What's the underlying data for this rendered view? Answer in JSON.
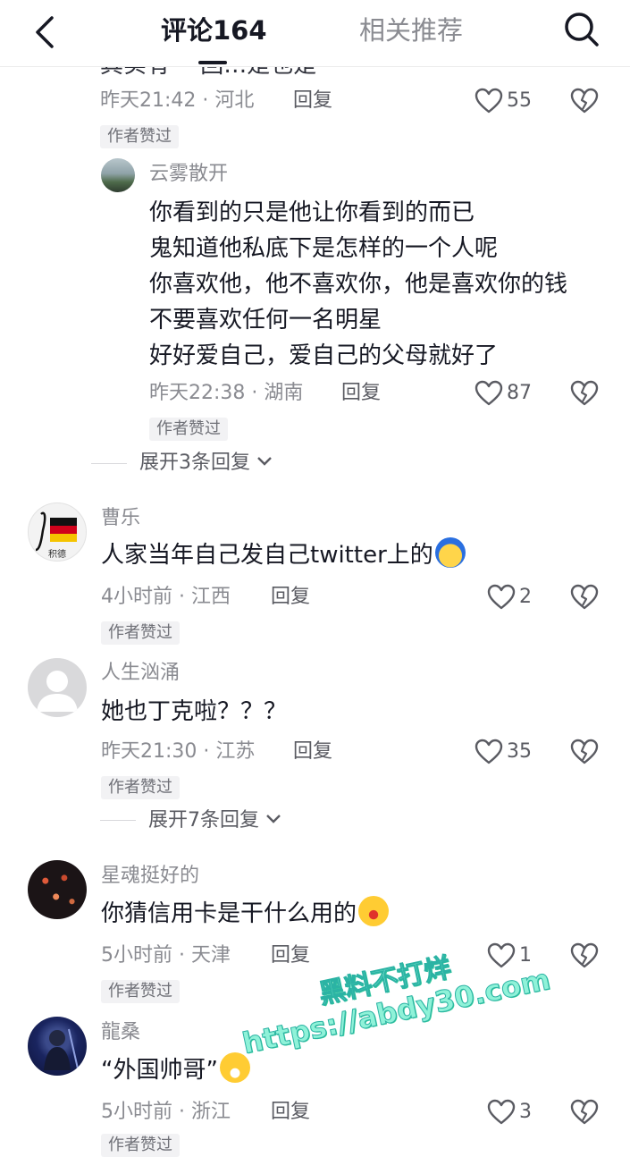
{
  "header": {
    "tab_comments": "评论164",
    "tab_related": "相关推荐"
  },
  "top_cut_text": "其实有 一回…是也是",
  "comments": [
    {
      "meta": "昨天21:42 · 河北",
      "reply": "回复",
      "likes": "55",
      "badge": "作者赞过",
      "sub_reply": {
        "username": "云雾散开",
        "lines": [
          "你看到的只是他让你看到的而已",
          "鬼知道他私底下是怎样的一个人呢",
          "你喜欢他，他不喜欢你，他是喜欢你的钱",
          "不要喜欢任何一名明星",
          "好好爱自己，爱自己的父母就好了"
        ],
        "meta": "昨天22:38 · 湖南",
        "reply": "回复",
        "likes": "87",
        "badge": "作者赞过"
      },
      "expand": "展开3条回复"
    },
    {
      "username": "曹乐",
      "avatar_caption": "积德",
      "text": "人家当年自己发自己twitter上的",
      "meta": "4小时前 · 江西",
      "reply": "回复",
      "likes": "2",
      "badge": "作者赞过"
    },
    {
      "username": "人生汹涌",
      "text": "她也丁克啦？？？",
      "meta": "昨天21:30 · 江苏",
      "reply": "回复",
      "likes": "35",
      "badge": "作者赞过",
      "expand": "展开7条回复"
    },
    {
      "username": "星魂挺好的",
      "text": "你猜信用卡是干什么用的",
      "meta": "5小时前 · 天津",
      "reply": "回复",
      "likes": "1",
      "badge": "作者赞过"
    },
    {
      "username": "龍桑",
      "text": "“外国帅哥”",
      "meta": "5小时前 · 浙江",
      "reply": "回复",
      "likes": "3",
      "badge": "作者赞过"
    }
  ],
  "watermark": {
    "line1": "黑料不打烊",
    "line2": "https://abdy30.com"
  },
  "colors": {
    "text": "#161823",
    "secondary": "#8a8b91",
    "badge_bg": "#f2f2f4",
    "watermark": "#8ff2d8"
  },
  "icons": [
    "back-icon",
    "search-icon",
    "heart-icon",
    "broken-heart-icon",
    "chevron-down-icon"
  ]
}
